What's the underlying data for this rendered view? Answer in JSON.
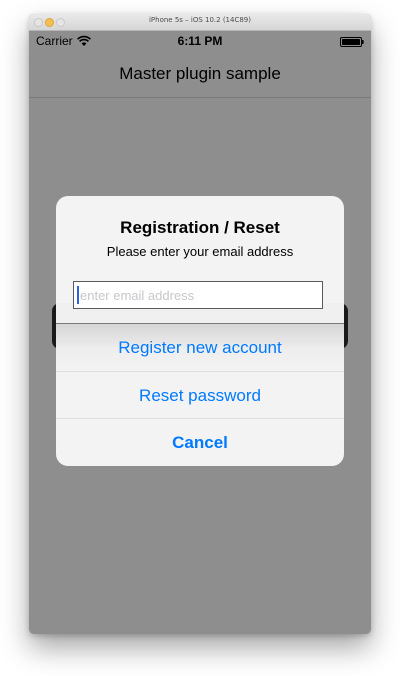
{
  "window": {
    "title": "iPhone 5s – iOS 10.2 (14C89)"
  },
  "status_bar": {
    "carrier": "Carrier",
    "time": "6:11 PM",
    "wifi_icon": "wifi-icon",
    "battery_icon": "battery-icon"
  },
  "nav_bar": {
    "title": "Master plugin sample"
  },
  "alert": {
    "title": "Registration / Reset",
    "message": "Please enter your email address",
    "email_field": {
      "value": "",
      "placeholder": "enter email address"
    },
    "actions": {
      "register_label": "Register new account",
      "reset_label": "Reset password",
      "cancel_label": "Cancel"
    }
  },
  "colors": {
    "accent": "#007aff",
    "dim_overlay": "#8e8e8e"
  }
}
